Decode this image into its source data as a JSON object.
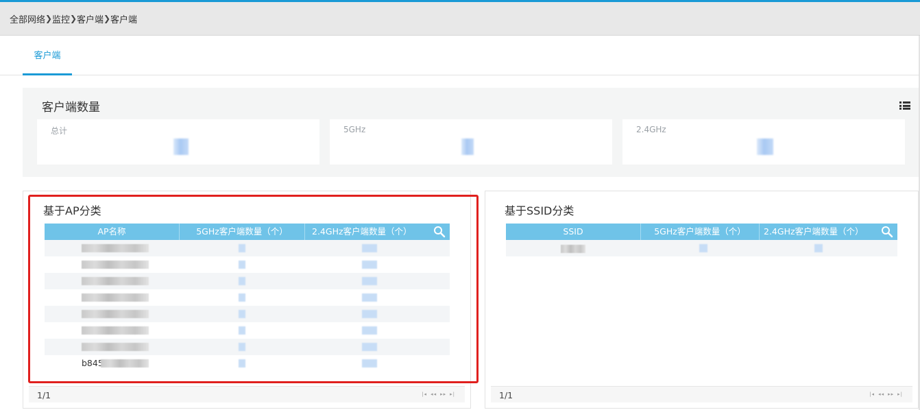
{
  "breadcrumb": [
    "全部网络",
    "监控",
    "客户端",
    "客户端"
  ],
  "tabs": [
    {
      "label": "客户端"
    }
  ],
  "client_count": {
    "title": "客户端数量",
    "cards": [
      {
        "label": "总计"
      },
      {
        "label": "5GHz"
      },
      {
        "label": "2.4GHz"
      }
    ]
  },
  "ap_panel": {
    "title": "基于AP分类",
    "columns": [
      "AP名称",
      "5GHz客户端数量（个）",
      "2.4GHz客户端数量（个）"
    ],
    "last_row_visible_text": "b845",
    "pager": "1/1"
  },
  "ssid_panel": {
    "title": "基于SSID分类",
    "columns": [
      "SSID",
      "5GHz客户端数量（个）",
      "2.4GHz客户端数量（个）"
    ],
    "pager": "1/1"
  },
  "pager_nav": [
    "|◂",
    "◂◂",
    "▸▸",
    "▸|"
  ],
  "colors": {
    "accent": "#1a9ad6",
    "grid_header": "#6fc3e8",
    "highlight": "#e0201e"
  }
}
